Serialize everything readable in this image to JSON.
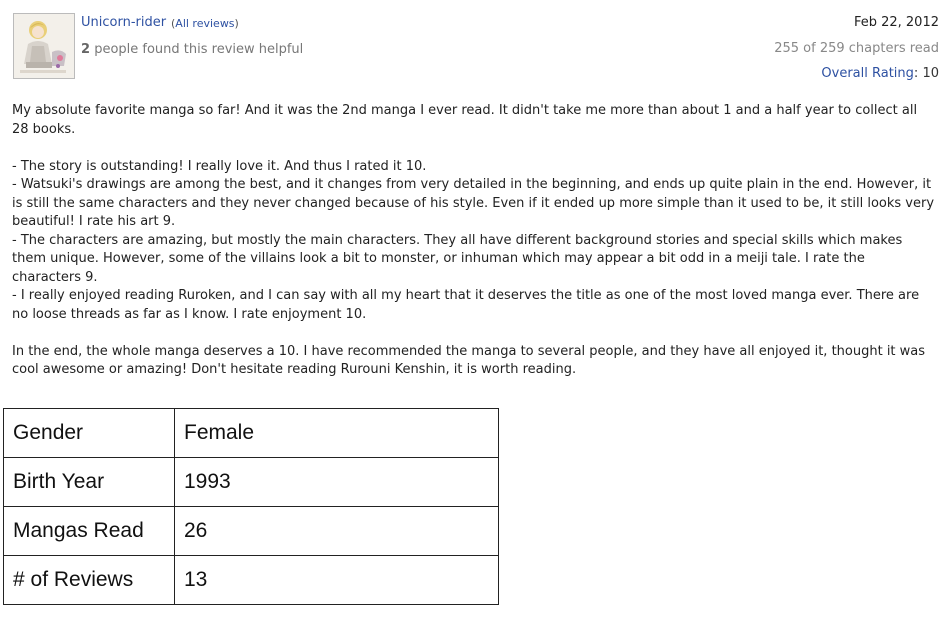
{
  "review": {
    "avatar_icon": "user-avatar-image",
    "username": "Unicorn-rider",
    "all_reviews_open": "(",
    "all_reviews_link": "All reviews",
    "all_reviews_close": ")",
    "helpful_count": "2",
    "helpful_text": "people found this review helpful",
    "date": "Feb 22, 2012",
    "progress": "255 of 259 chapters read",
    "rating_label": "Overall Rating",
    "rating_sep": ":",
    "rating_value": "10",
    "paragraphs": [
      "My absolute favorite manga so far! And it was the 2nd manga I ever read. It didn't take me more than about 1 and a half year to collect all 28 books.",
      "- The story is outstanding! I really love it. And thus I rated it 10.",
      "- Watsuki's drawings are among the best, and it changes from very detailed in the beginning, and ends up quite plain in the end. However, it is still the same characters and they never changed because of his style. Even if it ended up more simple than it used to be, it still looks very beautiful! I rate his art 9.",
      "- The characters are amazing, but mostly the main characters. They all have different background stories and special skills which makes them unique. However, some of the villains look a bit to monster, or inhuman which may appear a bit odd in a meiji tale. I rate the characters 9.",
      "- I really enjoyed reading Ruroken, and I can say with all my heart that it deserves the title as one of the most loved manga ever. There are no loose threads as far as I know. I rate enjoyment 10.",
      "In the end, the whole manga deserves a 10. I have recommended the manga to several people, and they have all enjoyed it, thought it was cool awesome or amazing! Don't hesitate reading Rurouni Kenshin, it is worth reading."
    ]
  },
  "stats": {
    "rows": [
      {
        "key": "Gender",
        "value": "Female"
      },
      {
        "key": "Birth Year",
        "value": "1993"
      },
      {
        "key": "Mangas Read",
        "value": "26"
      },
      {
        "key": "# of Reviews",
        "value": "13"
      }
    ]
  },
  "colors": {
    "link": "#2e51a2",
    "muted": "#888888"
  }
}
